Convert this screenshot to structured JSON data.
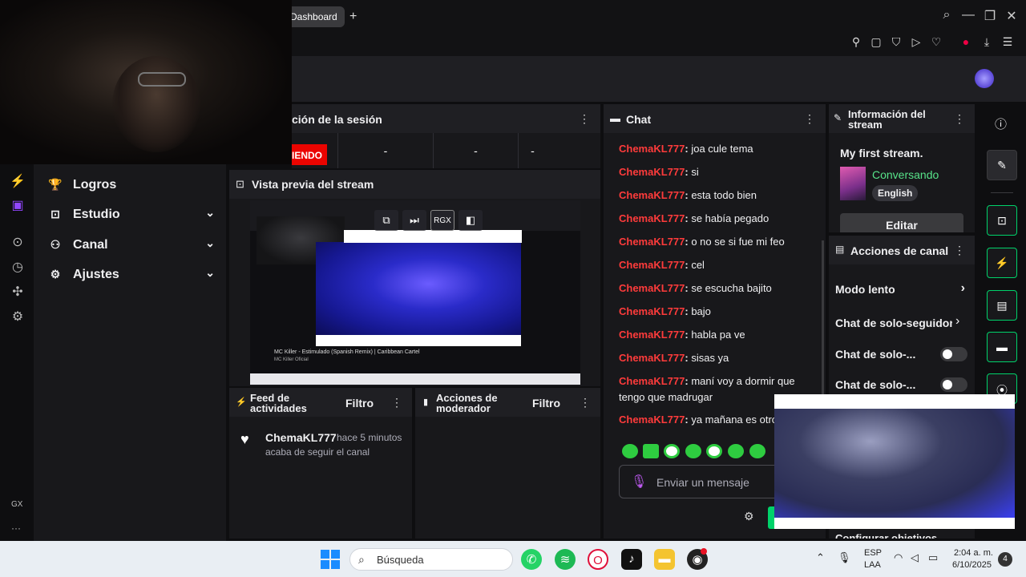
{
  "browser": {
    "tab_label": "Dashboard",
    "new_tab": "+"
  },
  "session": {
    "title": "ción de la sesión",
    "live_label": "IENDO",
    "cells": [
      "-",
      "-",
      "-"
    ]
  },
  "preview": {
    "title": "Vista previa del stream",
    "ctrl_label": "RGX",
    "video_title": "MC Killer - Estimulado (Spanish Remix) | Caribbean Cartel",
    "video_channel": "MC Killer Oficial"
  },
  "leftnav": {
    "items": [
      {
        "label": "Logros",
        "icon": "trophy-icon",
        "expandable": false
      },
      {
        "label": "Estudio",
        "icon": "studio-icon",
        "expandable": true
      },
      {
        "label": "Canal",
        "icon": "channel-icon",
        "expandable": true
      },
      {
        "label": "Ajustes",
        "icon": "gear-icon",
        "expandable": true
      }
    ],
    "gx": "GX",
    "more": "···"
  },
  "feed": {
    "title_line1": "Feed de",
    "title_line2": "actividades",
    "filter": "Filtro",
    "event_user": "ChemaKL777",
    "event_time": "hace 5 minutos",
    "event_desc": "acaba de seguir el canal"
  },
  "modact": {
    "title_line1": "Acciones de",
    "title_line2": "moderador",
    "filter": "Filtro"
  },
  "chat": {
    "title": "Chat",
    "messages": [
      {
        "user": "ChemaKL777",
        "text": "joa cule tema"
      },
      {
        "user": "ChemaKL777",
        "text": "si"
      },
      {
        "user": "ChemaKL777",
        "text": "esta todo bien"
      },
      {
        "user": "ChemaKL777",
        "text": "se había pegado"
      },
      {
        "user": "ChemaKL777",
        "text": "o no se si fue mi feo"
      },
      {
        "user": "ChemaKL777",
        "text": "cel"
      },
      {
        "user": "ChemaKL777",
        "text": "se escucha bajito"
      },
      {
        "user": "ChemaKL777",
        "text": "bajo"
      },
      {
        "user": "ChemaKL777",
        "text": "habla pa ve"
      },
      {
        "user": "ChemaKL777",
        "text": "sisas ya"
      },
      {
        "user": "ChemaKL777",
        "text": "maní voy a dormir que tengo que madrugar"
      },
      {
        "user": "ChemaKL777",
        "text": "ya mañana es otro"
      }
    ],
    "input_placeholder": "Enviar un mensaje"
  },
  "info": {
    "title_line1": "Información del",
    "title_line2": "stream",
    "stream_title": "My first stream.",
    "category": "Conversando",
    "language": "English",
    "edit": "Editar"
  },
  "actions": {
    "title": "Acciones de canal",
    "rows": [
      {
        "label": "Modo lento",
        "type": "chevron"
      },
      {
        "label": "Chat de solo-seguidor",
        "type": "chevron"
      },
      {
        "label": "Chat de solo-...",
        "type": "toggle"
      },
      {
        "label": "Chat de solo-...",
        "type": "toggle"
      }
    ],
    "partial_row": "Configurar objetivos"
  },
  "taskbar": {
    "search": "Búsqueda",
    "lang1": "ESP",
    "lang2": "LAA",
    "time": "2:04 a. m.",
    "date": "6/10/2025",
    "notif_count": "4"
  },
  "colors": {
    "accent_green": "#00d26a",
    "chat_user": "#ff3b3b",
    "live_red": "#eb0400",
    "category_green": "#57e389"
  }
}
